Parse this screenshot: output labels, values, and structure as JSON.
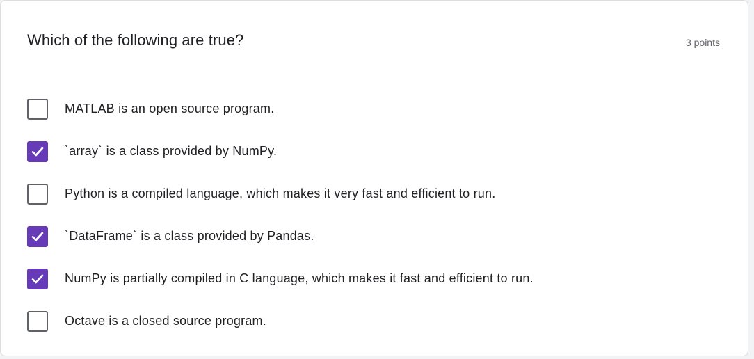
{
  "question": {
    "title": "Which of the following are true?",
    "points": "3 points"
  },
  "options": [
    {
      "label": "MATLAB is an open source program.",
      "checked": false
    },
    {
      "label": "`array` is a class provided by NumPy.",
      "checked": true
    },
    {
      "label": "Python is a compiled language, which makes it very fast and efficient to run.",
      "checked": false
    },
    {
      "label": "`DataFrame` is a class provided by Pandas.",
      "checked": true
    },
    {
      "label": "NumPy is partially compiled in C language, which makes it fast and efficient to run.",
      "checked": true
    },
    {
      "label": "Octave is a closed source program.",
      "checked": false
    }
  ],
  "colors": {
    "accent": "#673ab7",
    "text": "#202124",
    "muted": "#5f6368"
  },
  "icons": {
    "checked": "checkmark-icon"
  }
}
